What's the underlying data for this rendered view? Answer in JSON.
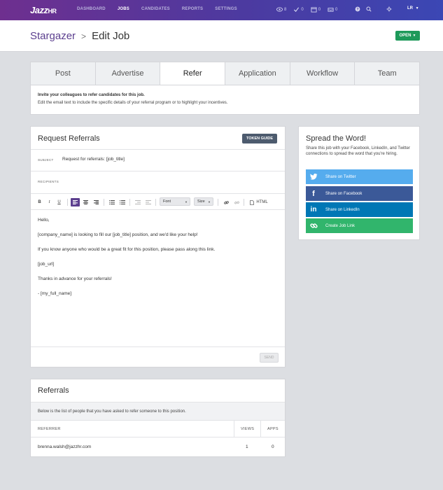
{
  "brand": {
    "logo_main": "Jazz",
    "logo_sub": "HR"
  },
  "nav": {
    "links": [
      {
        "label": "DASHBOARD",
        "active": false
      },
      {
        "label": "JOBS",
        "active": true
      },
      {
        "label": "CANDIDATES",
        "active": false
      },
      {
        "label": "REPORTS",
        "active": false
      },
      {
        "label": "SETTINGS",
        "active": false
      }
    ],
    "counters": [
      {
        "icon": "eye-icon",
        "count": "8"
      },
      {
        "icon": "check-icon",
        "count": "0"
      },
      {
        "icon": "calendar-icon",
        "count": "0"
      },
      {
        "icon": "inbox-icon",
        "count": "0"
      }
    ],
    "user_initials": "LR"
  },
  "header": {
    "job_link": "Stargazer",
    "separator": ">",
    "page": "Edit Job",
    "status_button": "OPEN"
  },
  "tabs": [
    "Post",
    "Advertise",
    "Refer",
    "Application",
    "Workflow",
    "Team"
  ],
  "active_tab": "Refer",
  "intro": {
    "bold": "Invite your colleagues to refer candidates for this job.",
    "note": "Edit the email text to include the specific details of your referral program or to highlight your incentives."
  },
  "request": {
    "title": "Request Referrals",
    "token_button": "TOKEN GUIDE",
    "subject_label": "SUBJECT",
    "subject_value": "Request for referrals: [job_title]",
    "recipients_label": "RECIPIENTS",
    "toolbar": {
      "bold": "B",
      "italic": "I",
      "underline": "U",
      "font": "Font",
      "size": "Size",
      "html": "HTML"
    },
    "body": [
      "Hello,",
      "[company_name] is looking to fill our [job_title] position, and we'd like your help!",
      "If you know anyone who would be a great fit for this position, please pass along this link.",
      "[job_url]",
      "Thanks in advance for your referrals!",
      "- [my_full_name]"
    ],
    "send_button": "SEND"
  },
  "spread": {
    "title": "Spread the Word!",
    "description": "Share this job with your Facebook, LinkedIn, and Twitter connections to spread the word that you're hiring.",
    "buttons": [
      {
        "label": "Share on Twitter",
        "icon": "twitter-icon",
        "color": "#55acee"
      },
      {
        "label": "Share on Facebook",
        "icon": "facebook-icon",
        "color": "#3b5998"
      },
      {
        "label": "Share on LinkedIn",
        "icon": "linkedin-icon",
        "color": "#0077b5"
      },
      {
        "label": "Create Job Link",
        "icon": "link-icon",
        "color": "#31b56c"
      }
    ]
  },
  "referrals": {
    "title": "Referrals",
    "description": "Below is the list of people that you have asked to refer someone to this position.",
    "columns": [
      "REFERRER",
      "VIEWS",
      "APPS"
    ],
    "rows": [
      {
        "referrer": "brenna.walsh@jazzhr.com",
        "views": "1",
        "apps": "0"
      }
    ]
  },
  "colors": {
    "accent": "#5b3e8e",
    "open_green": "#1e9a5a"
  }
}
